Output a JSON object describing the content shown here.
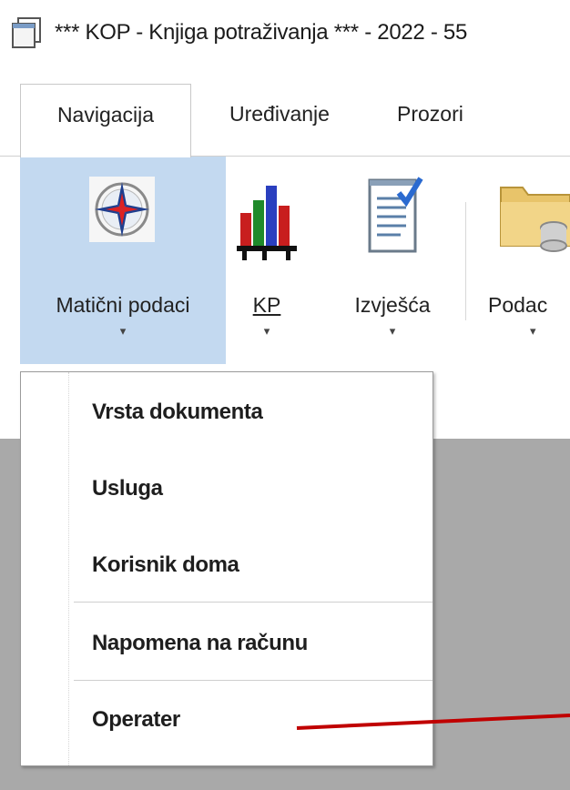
{
  "window": {
    "title": "*** KOP - Knjiga potraživanja *** - 2022 - 55"
  },
  "tabs": [
    {
      "label": "Navigacija",
      "active": true
    },
    {
      "label": "Uređivanje",
      "active": false
    },
    {
      "label": "Prozori",
      "active": false
    }
  ],
  "ribbon": {
    "buttons": [
      {
        "label": "Matični podaci",
        "icon": "compass-rose-icon",
        "selected": true
      },
      {
        "label": "KP",
        "icon": "bar-chart-icon",
        "selected": false
      },
      {
        "label": "Izvješća",
        "icon": "report-checklist-icon",
        "selected": false
      },
      {
        "label": "Podac",
        "icon": "folder-database-icon",
        "selected": false
      }
    ],
    "dropdown_arrow": "▾"
  },
  "dropdown": {
    "items": [
      {
        "label": "Vrsta dokumenta"
      },
      {
        "label": "Usluga"
      },
      {
        "label": "Korisnik doma"
      },
      {
        "label": "Napomena na računu"
      },
      {
        "label": "Operater"
      }
    ]
  },
  "colors": {
    "selected_button_bg": "#c3d9f0",
    "workspace_bg": "#a9a9a9",
    "annotation_line": "#c00000"
  }
}
